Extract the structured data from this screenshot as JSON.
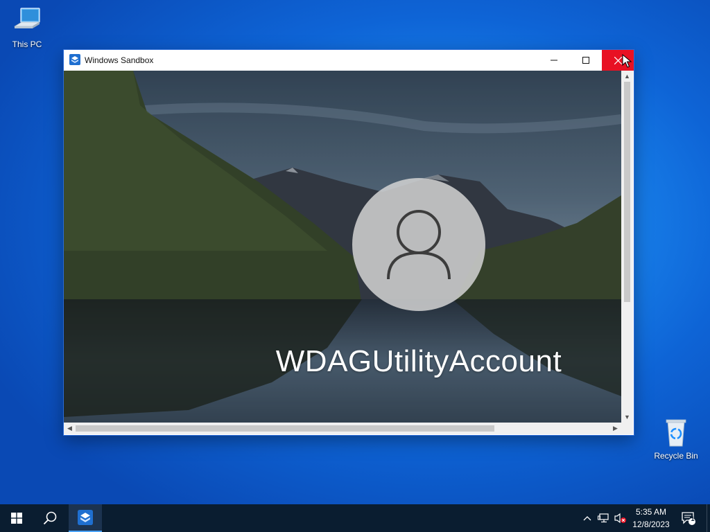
{
  "desktop": {
    "icons": [
      {
        "label": "This PC",
        "icon": "computer-icon"
      },
      {
        "label": "Recycle Bin",
        "icon": "recycle-bin-icon"
      }
    ]
  },
  "window": {
    "title": "Windows Sandbox",
    "app_icon": "windows-sandbox-icon",
    "controls": {
      "minimize": "minimize-icon",
      "maximize": "maximize-icon",
      "close": "close-icon"
    }
  },
  "lock_screen": {
    "avatar_icon": "user-avatar-icon",
    "username": "WDAGUtilityAccount"
  },
  "taskbar": {
    "start_icon": "windows-start-icon",
    "search_icon": "search-icon",
    "pinned": [
      {
        "label": "Windows Sandbox",
        "icon": "windows-sandbox-icon",
        "active": true
      }
    ],
    "tray": {
      "icons": [
        "chevron-up-icon",
        "network-icon",
        "volume-muted-icon"
      ],
      "time": "5:35 AM",
      "date": "12/8/2023",
      "notification_count": "1"
    }
  },
  "colors": {
    "close_button": "#e81123",
    "taskbar": "#0a1d30",
    "desktop_accent": "#1a86ee"
  }
}
